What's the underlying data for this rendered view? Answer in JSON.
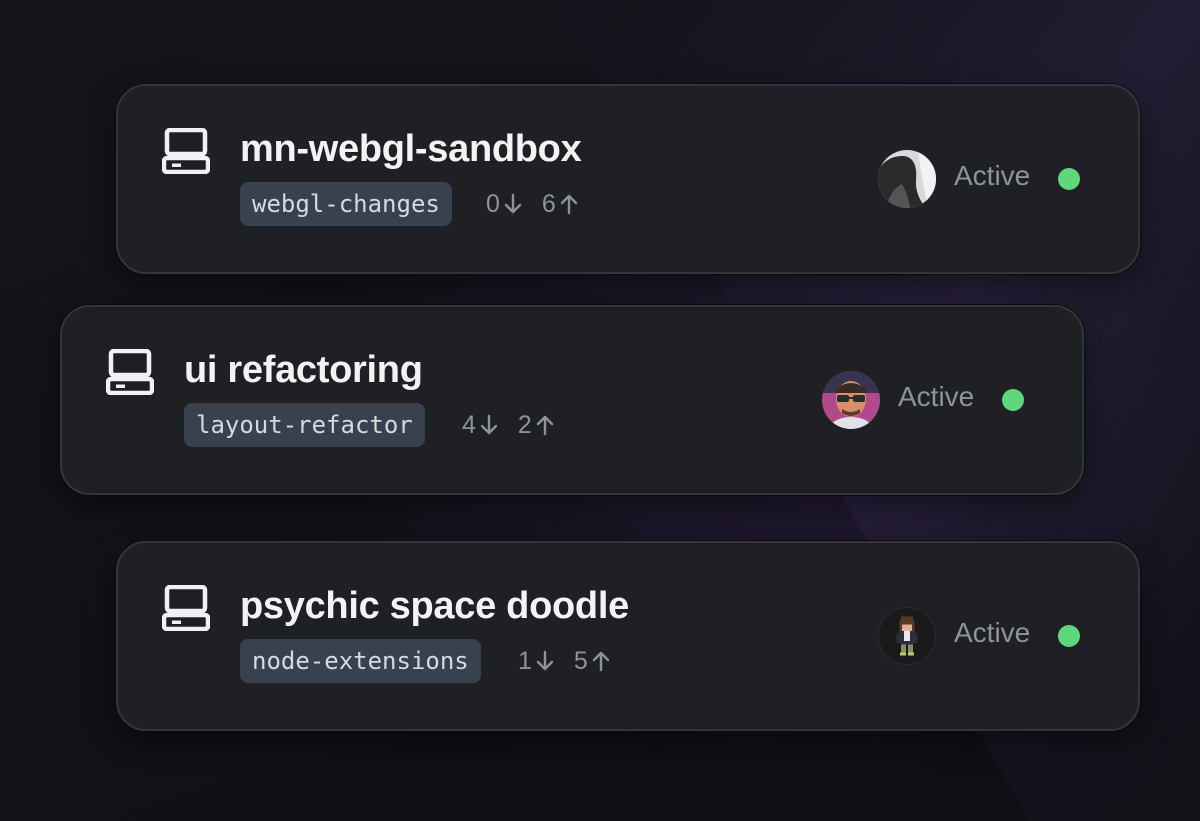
{
  "repos": [
    {
      "name": "mn-webgl-sandbox",
      "branch": "webgl-changes",
      "behind": "0",
      "ahead": "6",
      "status": "Active",
      "icon": "computer-icon",
      "avatar": "avatar-grayscale-photo"
    },
    {
      "name": "ui refactoring",
      "branch": "layout-refactor",
      "behind": "4",
      "ahead": "2",
      "status": "Active",
      "icon": "computer-icon",
      "avatar": "avatar-sunglasses-portrait"
    },
    {
      "name": "psychic space doodle",
      "branch": "node-extensions",
      "behind": "1",
      "ahead": "5",
      "status": "Active",
      "icon": "computer-icon",
      "avatar": "avatar-pixel-art"
    }
  ],
  "colors": {
    "status_dot": "#5ed87c",
    "card_bg": "#1f2024",
    "branch_bg": "#384150",
    "accent_glow": "#7a5cc0"
  }
}
